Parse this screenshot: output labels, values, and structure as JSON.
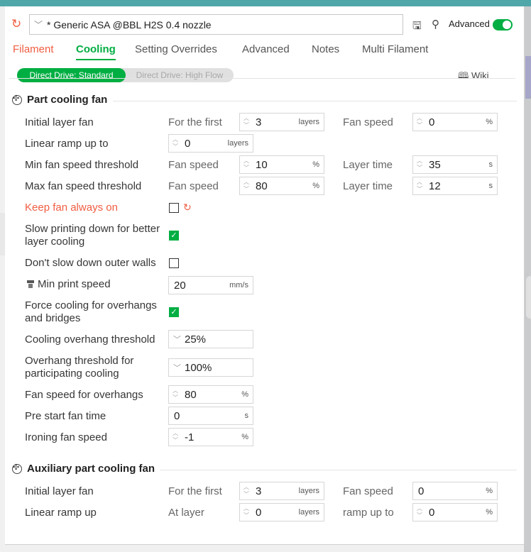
{
  "header": {
    "preset_name": "* Generic ASA @BBL H2S 0.4 nozzle",
    "advanced_label": "Advanced",
    "advanced_on": true
  },
  "tabs": [
    {
      "label": "Filament",
      "state": "modified"
    },
    {
      "label": "Cooling",
      "state": "active"
    },
    {
      "label": "Setting Overrides",
      "state": "normal"
    },
    {
      "label": "Advanced",
      "state": "normal"
    },
    {
      "label": "Notes",
      "state": "normal"
    },
    {
      "label": "Multi Filament",
      "state": "normal"
    }
  ],
  "subtabs": {
    "active": "Direct Drive: Standard",
    "inactive": "Direct Drive: High Flow"
  },
  "wiki_label": "Wiki",
  "part_cooling": {
    "title": "Part cooling fan",
    "initial_layer_fan": {
      "label": "Initial layer fan",
      "pre": "For the first",
      "value": "3",
      "unit": "layers",
      "fan_label": "Fan speed",
      "fan_value": "0",
      "fan_unit": "%"
    },
    "linear_ramp": {
      "label": "Linear ramp up to",
      "value": "0",
      "unit": "layers"
    },
    "min_fan": {
      "label": "Min fan speed threshold",
      "pre": "Fan speed",
      "value": "10",
      "unit": "%",
      "time_label": "Layer time",
      "time_value": "35",
      "time_unit": "s"
    },
    "max_fan": {
      "label": "Max fan speed threshold",
      "pre": "Fan speed",
      "value": "80",
      "unit": "%",
      "time_label": "Layer time",
      "time_value": "12",
      "time_unit": "s"
    },
    "keep_fan": {
      "label": "Keep fan always on",
      "checked": false
    },
    "slow_down": {
      "label": "Slow printing down for better layer cooling",
      "checked": true
    },
    "dont_slow": {
      "label": "Don't slow down outer walls",
      "checked": false
    },
    "min_print_speed": {
      "label": "Min print speed",
      "value": "20",
      "unit": "mm/s"
    },
    "force_cooling": {
      "label": "Force cooling for overhangs and bridges",
      "checked": true
    },
    "overhang_threshold": {
      "label": "Cooling overhang threshold",
      "value": "25%"
    },
    "overhang_participating": {
      "label": "Overhang threshold for participating cooling",
      "value": "100%"
    },
    "fan_overhangs": {
      "label": "Fan speed for overhangs",
      "value": "80",
      "unit": "%"
    },
    "pre_start": {
      "label": "Pre start fan time",
      "value": "0",
      "unit": "s"
    },
    "ironing_fan": {
      "label": "Ironing fan speed",
      "value": "-1",
      "unit": "%"
    }
  },
  "aux_cooling": {
    "title": "Auxiliary part cooling fan",
    "initial_layer_fan": {
      "label": "Initial layer fan",
      "pre": "For the first",
      "value": "3",
      "unit": "layers",
      "fan_label": "Fan speed",
      "fan_value": "0",
      "fan_unit": "%"
    },
    "linear_ramp": {
      "label": "Linear ramp up",
      "pre": "At layer",
      "value": "0",
      "unit": "layers",
      "ramp_label": "ramp up to",
      "ramp_value": "0",
      "ramp_unit": "%"
    }
  },
  "colors": {
    "accent": "#00ae42",
    "modified": "#f05d42",
    "titlebar": "#50a7aa"
  }
}
